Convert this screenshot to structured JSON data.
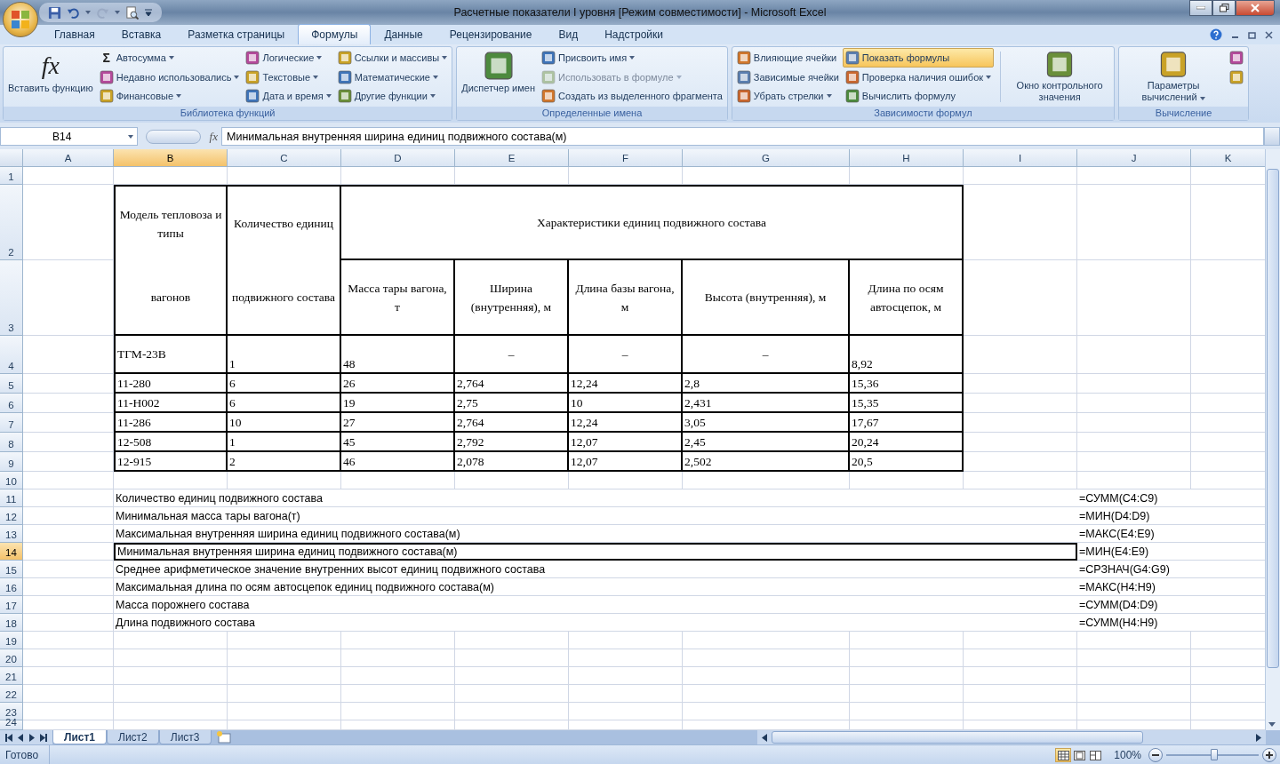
{
  "window": {
    "title": "Расчетные показатели I уровня  [Режим совместимости] - Microsoft Excel"
  },
  "ribbon_tabs": [
    {
      "label": "Главная",
      "selected": false
    },
    {
      "label": "Вставка",
      "selected": false
    },
    {
      "label": "Разметка страницы",
      "selected": false
    },
    {
      "label": "Формулы",
      "selected": true
    },
    {
      "label": "Данные",
      "selected": false
    },
    {
      "label": "Рецензирование",
      "selected": false
    },
    {
      "label": "Вид",
      "selected": false
    },
    {
      "label": "Надстройки",
      "selected": false
    }
  ],
  "ribbon_groups": [
    {
      "label": "Библиотека функций",
      "controls": [
        {
          "kind": "large",
          "label": "Вставить функцию",
          "symbol": "fx",
          "dropdown": false
        },
        {
          "kind": "column",
          "items": [
            {
              "symbol": "Σ",
              "label": "Автосумма",
              "dropdown": true,
              "disabled": false,
              "active": false
            },
            {
              "label": "Недавно использовались",
              "dropdown": true,
              "disabled": false,
              "active": false
            },
            {
              "label": "Финансовые",
              "dropdown": true,
              "disabled": false,
              "active": false
            }
          ]
        },
        {
          "kind": "column",
          "items": [
            {
              "label": "Логические",
              "dropdown": true,
              "disabled": false,
              "active": false
            },
            {
              "label": "Текстовые",
              "dropdown": true,
              "disabled": false,
              "active": false
            },
            {
              "label": "Дата и время",
              "dropdown": true,
              "disabled": false,
              "active": false
            }
          ]
        },
        {
          "kind": "column",
          "items": [
            {
              "label": "Ссылки и массивы",
              "dropdown": true,
              "disabled": false,
              "active": false
            },
            {
              "label": "Математические",
              "dropdown": true,
              "disabled": false,
              "active": false
            },
            {
              "label": "Другие функции",
              "dropdown": true,
              "disabled": false,
              "active": false
            }
          ]
        }
      ]
    },
    {
      "label": "Определенные имена",
      "controls": [
        {
          "kind": "large",
          "label": "Диспетчер имен",
          "dropdown": false
        },
        {
          "kind": "column",
          "items": [
            {
              "label": "Присвоить имя",
              "dropdown": true,
              "disabled": false,
              "active": false
            },
            {
              "label": "Использовать в формуле",
              "dropdown": true,
              "disabled": true,
              "active": false
            },
            {
              "label": "Создать из выделенного фрагмента",
              "dropdown": false,
              "disabled": false,
              "active": false
            }
          ]
        }
      ]
    },
    {
      "label": "Зависимости формул",
      "controls": [
        {
          "kind": "column",
          "items": [
            {
              "label": "Влияющие ячейки",
              "dropdown": false,
              "disabled": false,
              "active": false
            },
            {
              "label": "Зависимые ячейки",
              "dropdown": false,
              "disabled": false,
              "active": false
            },
            {
              "label": "Убрать стрелки",
              "dropdown": true,
              "disabled": false,
              "active": false
            }
          ]
        },
        {
          "kind": "column",
          "items": [
            {
              "label": "Показать формулы",
              "dropdown": false,
              "disabled": false,
              "active": true
            },
            {
              "label": "Проверка наличия ошибок",
              "dropdown": true,
              "disabled": false,
              "active": false
            },
            {
              "label": "Вычислить формулу",
              "dropdown": false,
              "disabled": false,
              "active": false
            }
          ]
        },
        {
          "kind": "separator"
        },
        {
          "kind": "large",
          "label": "Окно контрольного значения",
          "dropdown": false
        }
      ]
    },
    {
      "label": "Вычисление",
      "controls": [
        {
          "kind": "large",
          "label": "Параметры вычислений",
          "dropdown": true
        },
        {
          "kind": "column",
          "items": [
            {
              "dropdown": false,
              "disabled": false,
              "active": false
            },
            {
              "dropdown": false,
              "disabled": false,
              "active": false
            }
          ]
        }
      ]
    }
  ],
  "formula_bar": {
    "name_box": "B14",
    "fx": "fx",
    "value": "Минимальная внутренняя ширина единиц подвижного состава(м)"
  },
  "sheet": {
    "columns": [
      {
        "label": "A",
        "selected": false
      },
      {
        "label": "B",
        "selected": true
      },
      {
        "label": "C",
        "selected": false
      },
      {
        "label": "D",
        "selected": false
      },
      {
        "label": "E",
        "selected": false
      },
      {
        "label": "F",
        "selected": false
      },
      {
        "label": "G",
        "selected": false
      },
      {
        "label": "H",
        "selected": false
      },
      {
        "label": "I",
        "selected": false
      },
      {
        "label": "J",
        "selected": false
      },
      {
        "label": "K",
        "selected": false
      }
    ],
    "rows": [
      {
        "label": "1",
        "selected": false
      },
      {
        "label": "2",
        "selected": false
      },
      {
        "label": "3",
        "selected": false
      },
      {
        "label": "4",
        "selected": false
      },
      {
        "label": "5",
        "selected": false
      },
      {
        "label": "6",
        "selected": false
      },
      {
        "label": "7",
        "selected": false
      },
      {
        "label": "8",
        "selected": false
      },
      {
        "label": "9",
        "selected": false
      },
      {
        "label": "10",
        "selected": false
      },
      {
        "label": "11",
        "selected": false
      },
      {
        "label": "12",
        "selected": false
      },
      {
        "label": "13",
        "selected": false
      },
      {
        "label": "14",
        "selected": true
      },
      {
        "label": "15",
        "selected": false
      },
      {
        "label": "16",
        "selected": false
      },
      {
        "label": "17",
        "selected": false
      },
      {
        "label": "18",
        "selected": false
      },
      {
        "label": "19",
        "selected": false
      },
      {
        "label": "20",
        "selected": false
      },
      {
        "label": "21",
        "selected": false
      },
      {
        "label": "22",
        "selected": false
      },
      {
        "label": "23",
        "selected": false
      },
      {
        "label": "24",
        "selected": false
      }
    ],
    "table": {
      "header_top": [
        "Модель тепловоза и типы",
        "Количество единиц",
        "Характеристики единиц подвижного состава"
      ],
      "header_bottom": [
        "вагонов",
        "подвижного состава",
        "Масса тары вагона, т",
        "Ширина (внутренняя), м",
        "Длина базы вагона, м",
        "Высота (внутренняя), м",
        "Длина по осям автосцепок, м"
      ],
      "rows": [
        [
          {
            "text": "ТГМ-23В",
            "kind": "middle"
          },
          "1",
          "48",
          {
            "text": "–",
            "kind": "centered"
          },
          {
            "text": "–",
            "kind": "centered"
          },
          {
            "text": "–",
            "kind": "centered"
          },
          "8,92"
        ],
        [
          "11-280",
          "6",
          "26",
          "2,764",
          "12,24",
          "2,8",
          "15,36"
        ],
        [
          "11-Н002",
          "6",
          "19",
          "2,75",
          "10",
          "2,431",
          "15,35"
        ],
        [
          "11-286",
          "10",
          "27",
          "2,764",
          "12,24",
          "3,05",
          "17,67"
        ],
        [
          "12-508",
          "1",
          "45",
          "2,792",
          "12,07",
          "2,45",
          "20,24"
        ],
        [
          "12-915",
          "2",
          "46",
          "2,078",
          "12,07",
          "2,502",
          "20,5"
        ]
      ]
    },
    "summary": [
      {
        "label": "Количество единиц подвижного состава",
        "formula": "=СУММ(C4:C9)",
        "selected": false
      },
      {
        "label": "Минимальная масса тары вагона(т)",
        "formula": "=МИН(D4:D9)",
        "selected": false
      },
      {
        "label": "Максимальная внутренняя ширина единиц подвижного состава(м)",
        "formula": "=МАКС(E4:E9)",
        "selected": false
      },
      {
        "label": "Минимальная внутренняя ширина единиц подвижного состава(м)",
        "formula": "=МИН(E4:E9)",
        "selected": true
      },
      {
        "label": "Среднее арифметическое значение внутренних высот единиц подвижного состава",
        "formula": "=СРЗНАЧ(G4:G9)",
        "selected": false
      },
      {
        "label": "Максимальная длина по осям автосцепок единиц подвижного состава(м)",
        "formula": "=МАКС(H4:H9)",
        "selected": false
      },
      {
        "label": "Масса порожнего состава",
        "formula": "=СУММ(D4:D9)",
        "selected": false
      },
      {
        "label": "Длина подвижного состава",
        "formula": "=СУММ(H4:H9)",
        "selected": false
      }
    ]
  },
  "sheet_tabs": [
    {
      "label": "Лист1",
      "selected": true
    },
    {
      "label": "Лист2",
      "selected": false
    },
    {
      "label": "Лист3",
      "selected": false
    }
  ],
  "status_bar": {
    "text": "Готово",
    "views": [
      {
        "selected": true
      },
      {
        "selected": false
      },
      {
        "selected": false
      }
    ],
    "zoom": {
      "label": "100%",
      "level": 0.52
    }
  }
}
